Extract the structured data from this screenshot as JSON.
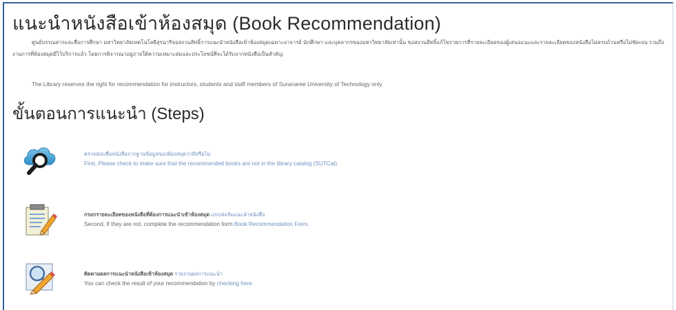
{
  "page": {
    "title": "แนะนำหนังสือเข้าห้องสมุด (Book Recommendation)",
    "intro_th": "ศูนย์บรรณสารและสื่อการศึกษา มหาวิทยาลัยเทคโนโลยีสุรนารีขอสงวนสิทธิ์การแนะนำหนังสือเข้าห้องสมุดเฉพาะอาจารย์ นักศึกษา และบุคลากรของมหาวิทยาลัยเท่านั้น ขอสงวนสิทธิ์แก้ไขรายการที่รายละเอียดของผู้เสนอแนะและรายละเอียดของหนังสือไม่ครบถ้วนหรือไม่ชัดเจน รวมถึงงานการที่ห้องสมุดมีไว้บริการแล้ว โดยการพิจารณาอยู่ภายใต้ความเหมาะสมและประโยชน์ที่จะได้รับจากหนังสือเป็นสำคัญ",
    "intro_en": "The Library reserves the right for recommendation for instructors, students and staff members of Suranaree University of Technology only.",
    "steps_title": "ขั้นตอนการแนะนำ (Steps)"
  },
  "steps": [
    {
      "icon": "cloud-search-icon",
      "th_text": "ตรวจสอบชื่อหนังสือจากฐานข้อมูลของห้องสมุดว่ามีหรือไม่",
      "th_link": "",
      "en_text": "First, Please check to make sure that the recommended books are not in the library catalog (SUTCat)",
      "en_link": ""
    },
    {
      "icon": "form-edit-icon",
      "th_text": "กรอกรายละเอียดของหนังสือที่ต้องการแนะนำเข้าห้องสมุด ",
      "th_link": "แบบฟอร์มแนะนำหนังสือ",
      "en_text": "Second, If they are not, complete the recommendation form ",
      "en_link": "Book Recommendation Form."
    },
    {
      "icon": "search-edit-icon",
      "th_text": "ติดตามผลการแนะนำหนังสือเข้าห้องสมุด ",
      "th_link": "รายงานผลการแนะนำ",
      "en_text": "You can check the result of your recommendation by ",
      "en_link": "checking here."
    }
  ],
  "colors": {
    "link": "#6d8fc0",
    "frame": "#2e5f9b"
  }
}
